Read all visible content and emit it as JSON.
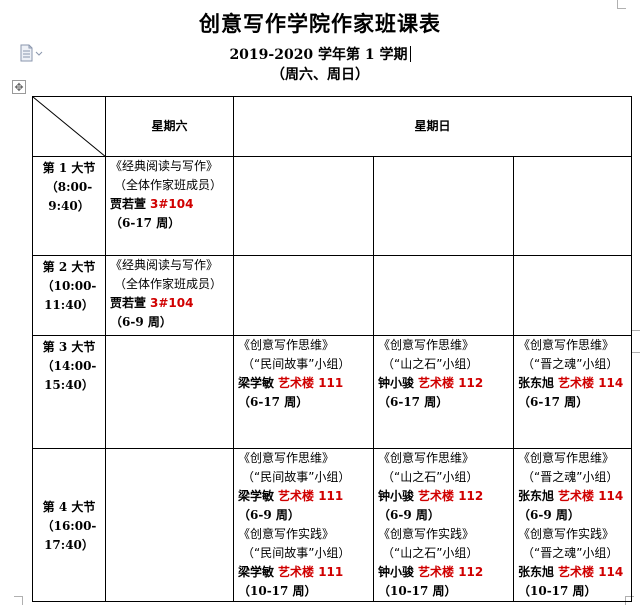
{
  "title": "创意写作学院作家班课表",
  "subtitle_year": "2019-2020 学年第 1 学期",
  "subtitle_days": "（周六、周日）",
  "header": {
    "saturday": "星期六",
    "sunday": "星期日"
  },
  "icons": {
    "doc": "document-icon",
    "move": "move-handle-icon"
  },
  "periods": [
    {
      "name": "第 1 大节",
      "time1": "（8:00-",
      "time2": "9:40）"
    },
    {
      "name": "第 2 大节",
      "time1": "（10:00-",
      "time2": "11:40）"
    },
    {
      "name": "第 3 大节",
      "time1": "（14:00-",
      "time2": "15:40）"
    },
    {
      "name": "第 4 大节",
      "time1": "（16:00-",
      "time2": "17:40）"
    }
  ],
  "saturday": [
    {
      "course": "《经典阅读与写作》",
      "group": "（全体作家班成员）",
      "teacher": "贾若萱",
      "room": "3#104",
      "weeks": "（6-17 周）"
    },
    {
      "course": "《经典阅读与写作》",
      "group": "（全体作家班成员）",
      "teacher": "贾若萱",
      "room": "3#104",
      "weeks": "（6-9 周）"
    }
  ],
  "sunday_p3": [
    {
      "course": "《创意写作思维》",
      "group": "（“民间故事”小组）",
      "teacher": "梁学敏",
      "room": "艺术楼 111",
      "weeks": "（6-17 周）"
    },
    {
      "course": "《创意写作思维》",
      "group": "（“山之石”小组）",
      "teacher": "钟小骏",
      "room": "艺术楼 112",
      "weeks": "（6-17 周）"
    },
    {
      "course": "《创意写作思维》",
      "group": "（“晋之魂”小组）",
      "teacher": "张东旭",
      "room": "艺术楼 114",
      "weeks": "（6-17 周）"
    }
  ],
  "sunday_p4": [
    {
      "a": {
        "course": "《创意写作思维》",
        "group": "（“民间故事”小组）",
        "teacher": "梁学敏",
        "room": "艺术楼 111",
        "weeks": "（6-9 周）"
      },
      "b": {
        "course": "《创意写作实践》",
        "group": "（“民间故事”小组）",
        "teacher": "梁学敏",
        "room": "艺术楼 111",
        "weeks": "（10-17 周）"
      }
    },
    {
      "a": {
        "course": "《创意写作思维》",
        "group": "（“山之石”小组）",
        "teacher": "钟小骏",
        "room": "艺术楼 112",
        "weeks": "（6-9 周）"
      },
      "b": {
        "course": "《创意写作实践》",
        "group": "（“山之石”小组）",
        "teacher": "钟小骏",
        "room": "艺术楼 112",
        "weeks": "（10-17 周）"
      }
    },
    {
      "a": {
        "course": "《创意写作思维》",
        "group": "（“晋之魂”小组）",
        "teacher": "张东旭",
        "room": "艺术楼 114",
        "weeks": "（6-9 周）"
      },
      "b": {
        "course": "《创意写作实践》",
        "group": "（“晋之魂”小组）",
        "teacher": "张东旭",
        "room": "艺术楼 114",
        "weeks": "（10-17 周）"
      }
    }
  ]
}
